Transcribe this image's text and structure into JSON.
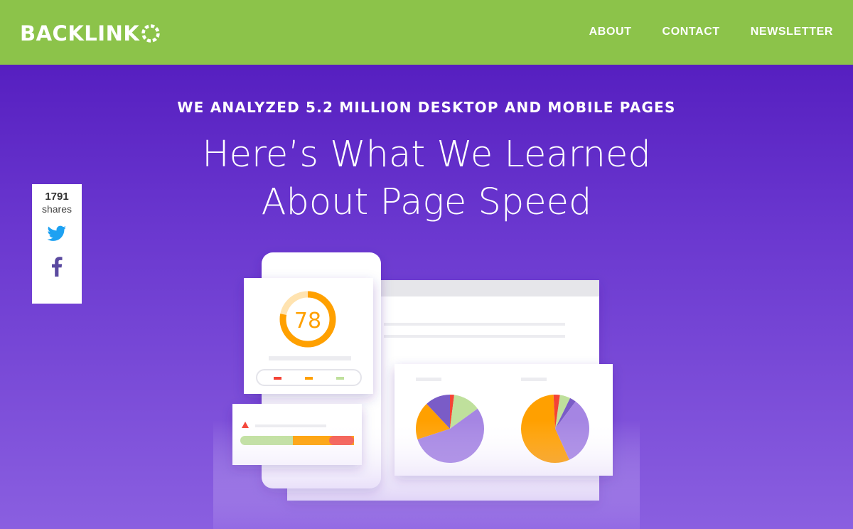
{
  "brand": {
    "name": "BACKLINK",
    "color_primary": "#8cc34a",
    "color_hero_top": "#561fc0",
    "color_hero_bottom": "#8a5fe0"
  },
  "nav": {
    "items": [
      {
        "label": "ABOUT"
      },
      {
        "label": "CONTACT"
      },
      {
        "label": "NEWSLETTER"
      }
    ]
  },
  "hero": {
    "kicker": "WE ANALYZED 5.2 MILLION DESKTOP AND MOBILE PAGES",
    "headline_line1": "Here’s What We Learned",
    "headline_line2": "About Page Speed"
  },
  "share": {
    "count": "1791",
    "label": "shares",
    "twitter_icon": "twitter-icon",
    "facebook_icon": "facebook-icon"
  },
  "illustration": {
    "score": "78",
    "score_fraction": 0.78,
    "score_color": "#ffa000",
    "pie_colors": [
      "#a585e3",
      "#ffa000",
      "#7a5cc7",
      "#bfe09c",
      "#f44336"
    ]
  }
}
